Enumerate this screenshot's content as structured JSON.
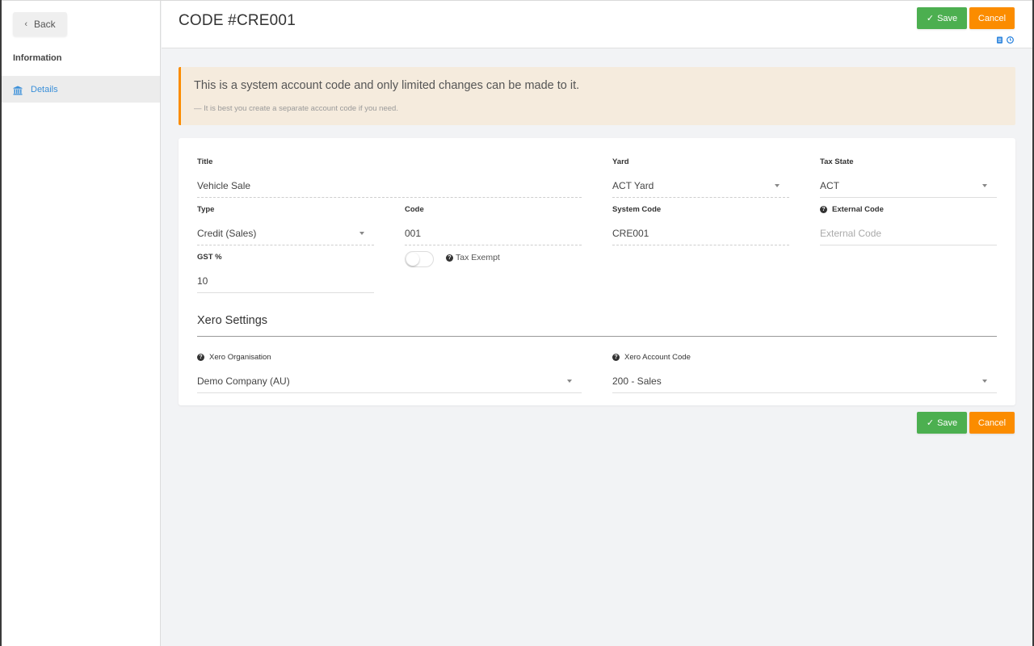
{
  "sidebar": {
    "back_label": "Back",
    "heading": "Information",
    "items": [
      {
        "label": "Details",
        "icon": "bank-icon",
        "active": true
      }
    ]
  },
  "header": {
    "title": "CODE #CRE001",
    "save_label": "Save",
    "cancel_label": "Cancel",
    "icons": [
      "clipboard-icon",
      "clock-icon"
    ]
  },
  "alert": {
    "title": "This is a system account code and only limited changes can be made to it.",
    "subtitle": "— It is best you create a separate account code if you need."
  },
  "form": {
    "title": {
      "label": "Title",
      "value": "Vehicle Sale"
    },
    "yard": {
      "label": "Yard",
      "value": "ACT Yard"
    },
    "tax_state": {
      "label": "Tax State",
      "value": "ACT"
    },
    "type": {
      "label": "Type",
      "value": "Credit (Sales)"
    },
    "code": {
      "label": "Code",
      "value": "001"
    },
    "system_code": {
      "label": "System Code",
      "value": "CRE001"
    },
    "external_code": {
      "label": "External Code",
      "value": "",
      "placeholder": "External Code"
    },
    "gst": {
      "label": "GST %",
      "value": "10"
    },
    "tax_exempt": {
      "label": "Tax Exempt",
      "checked": false
    }
  },
  "xero": {
    "section_title": "Xero Settings",
    "organisation": {
      "label": "Xero Organisation",
      "value": "Demo Company (AU)"
    },
    "account_code": {
      "label": "Xero Account Code",
      "value": "200 - Sales"
    }
  },
  "footer": {
    "save_label": "Save",
    "cancel_label": "Cancel"
  },
  "colors": {
    "accent_blue": "#3a8fd9",
    "save_green": "#4caf50",
    "cancel_orange": "#fb8c00",
    "alert_bg": "#f5ebdd"
  }
}
